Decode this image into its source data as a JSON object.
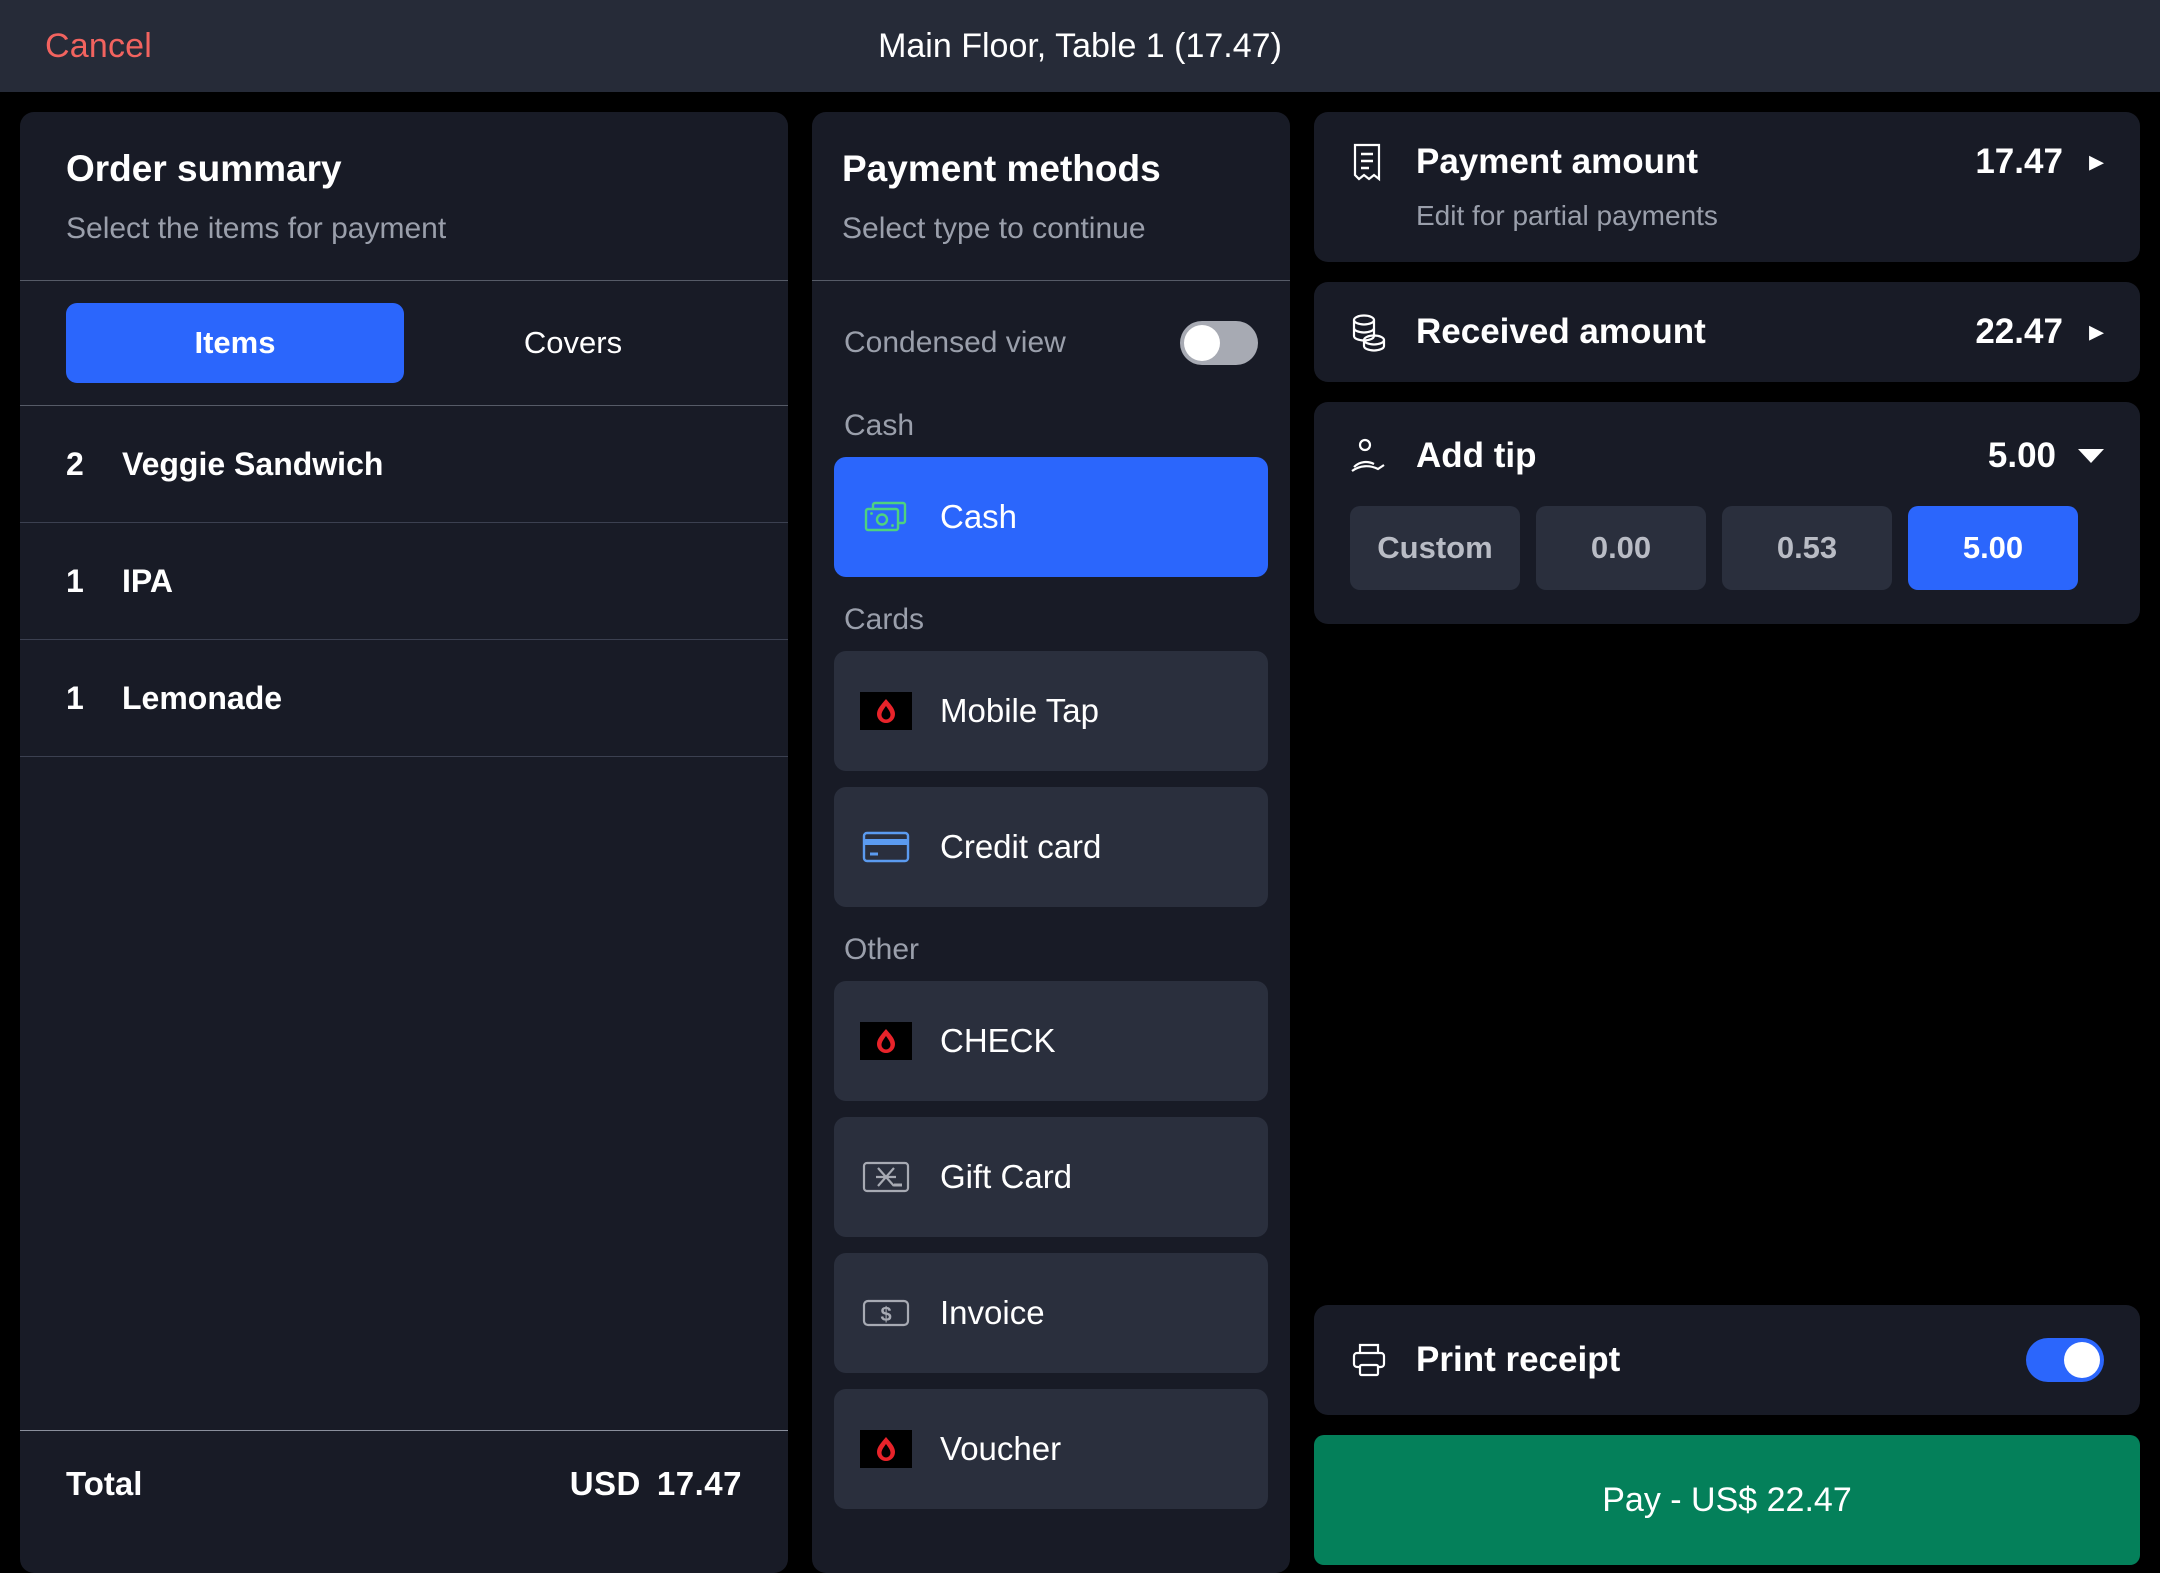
{
  "header": {
    "cancel_label": "Cancel",
    "title": "Main Floor, Table 1 (17.47)"
  },
  "order_summary": {
    "title": "Order summary",
    "subtitle": "Select the items for payment",
    "tabs": [
      {
        "label": "Items",
        "active": true
      },
      {
        "label": "Covers",
        "active": false
      }
    ],
    "items": [
      {
        "qty": "2",
        "name": "Veggie Sandwich"
      },
      {
        "qty": "1",
        "name": "IPA"
      },
      {
        "qty": "1",
        "name": "Lemonade"
      }
    ],
    "total_label": "Total",
    "total_currency": "USD",
    "total_amount": "17.47"
  },
  "payment_methods": {
    "title": "Payment methods",
    "subtitle": "Select type to continue",
    "condensed_view_label": "Condensed view",
    "condensed_view_on": false,
    "groups": [
      {
        "label": "Cash",
        "methods": [
          {
            "label": "Cash",
            "icon": "banknote-icon",
            "selected": true
          }
        ]
      },
      {
        "label": "Cards",
        "methods": [
          {
            "label": "Mobile Tap",
            "icon": "lightspeed-flame-icon",
            "selected": false
          },
          {
            "label": "Credit card",
            "icon": "credit-card-icon",
            "selected": false
          }
        ]
      },
      {
        "label": "Other",
        "methods": [
          {
            "label": "CHECK",
            "icon": "lightspeed-flame-icon",
            "selected": false
          },
          {
            "label": "Gift Card",
            "icon": "gift-card-icon",
            "selected": false
          },
          {
            "label": "Invoice",
            "icon": "dollar-note-icon",
            "selected": false
          },
          {
            "label": "Voucher",
            "icon": "lightspeed-flame-icon",
            "selected": false
          }
        ]
      }
    ]
  },
  "payment_panel": {
    "payment_amount": {
      "label": "Payment amount",
      "value": "17.47",
      "hint": "Edit for partial payments",
      "icon": "receipt-icon"
    },
    "received_amount": {
      "label": "Received amount",
      "value": "22.47",
      "icon": "coins-icon"
    },
    "tip": {
      "label": "Add tip",
      "value": "5.00",
      "icon": "hand-coin-icon",
      "options": [
        {
          "label": "Custom",
          "selected": false
        },
        {
          "label": "0.00",
          "selected": false
        },
        {
          "label": "0.53",
          "selected": false
        },
        {
          "label": "5.00",
          "selected": true
        }
      ]
    },
    "print_receipt": {
      "label": "Print receipt",
      "icon": "printer-icon",
      "on": true
    },
    "pay_button": {
      "label": "Pay - US$ 22.47"
    }
  },
  "colors": {
    "accent_blue": "#2b66fc",
    "pay_green": "#04805a",
    "cancel_red": "#f2635f",
    "panel_bg": "#181b26",
    "card_bg": "#2a2f3d",
    "header_bg": "#262b38"
  }
}
